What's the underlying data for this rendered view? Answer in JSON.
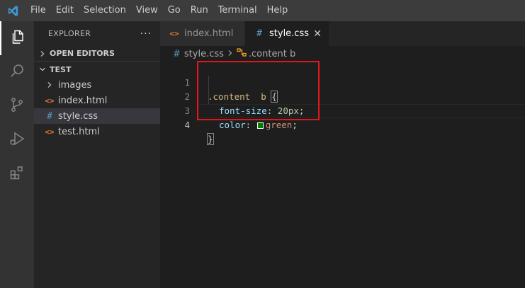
{
  "menu": [
    "File",
    "Edit",
    "Selection",
    "View",
    "Go",
    "Run",
    "Terminal",
    "Help"
  ],
  "sidebar": {
    "title": "EXPLORER",
    "more": "···",
    "open_editors": "OPEN EDITORS",
    "folder": "TEST",
    "items": [
      {
        "label": "images",
        "type": "folder"
      },
      {
        "label": "index.html",
        "type": "html"
      },
      {
        "label": "style.css",
        "type": "css"
      },
      {
        "label": "test.html",
        "type": "html"
      }
    ]
  },
  "tabs": [
    {
      "label": "index.html",
      "icon": "<>"
    },
    {
      "label": "style.css",
      "icon": "#",
      "close": "✕"
    }
  ],
  "breadcrumb": {
    "file_icon": "#",
    "file": "style.css",
    "symbol": ".content  b"
  },
  "editor": {
    "line_numbers": [
      "1",
      "2",
      "3",
      "4"
    ],
    "selector": ".content  b ",
    "open_brace": "{",
    "prop1": "font-size",
    "val1": "20px",
    "prop2": "color",
    "val2": "green",
    "close_brace": "}",
    "swatch_color": "#008000"
  },
  "colors": {
    "highlight_box": "#e3161a",
    "accent": "#007acc"
  },
  "icons": {
    "html": "<>",
    "css": "#"
  }
}
